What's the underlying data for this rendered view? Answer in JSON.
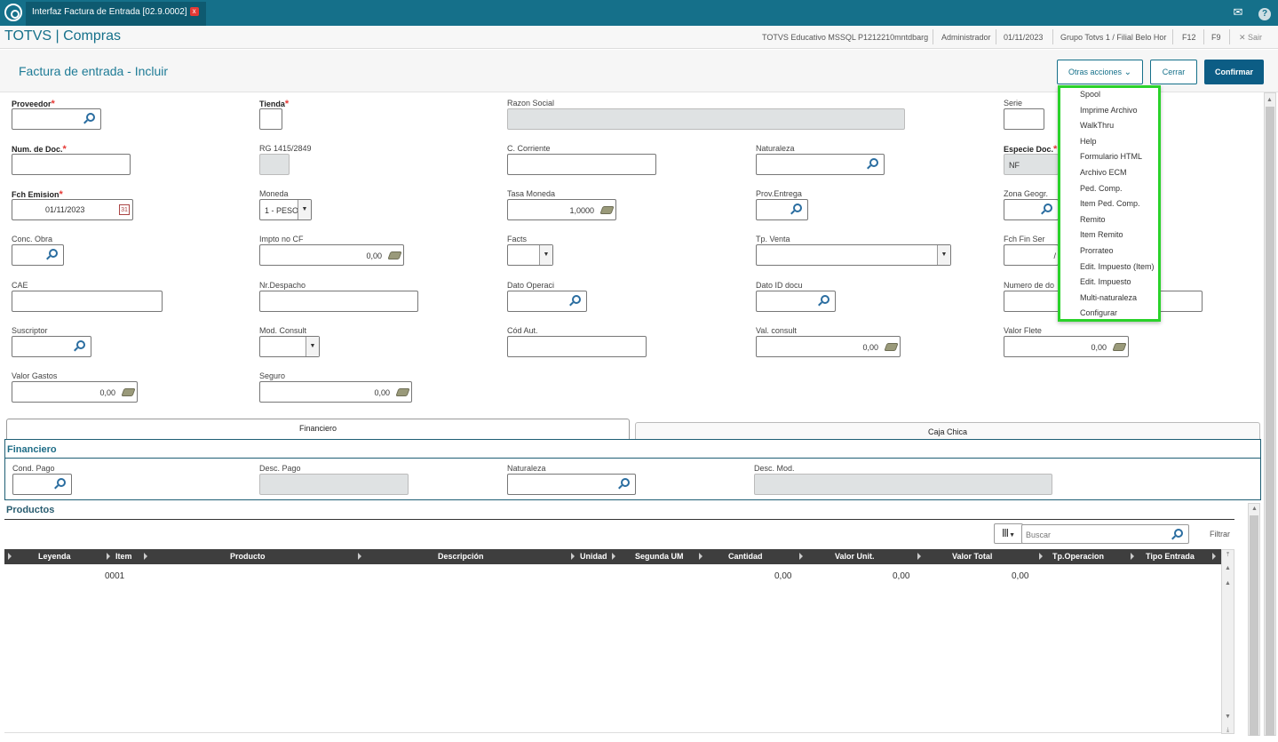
{
  "window": {
    "tab_title": "Interfaz Factura de Entrada [02.9.0002]",
    "close_glyph": "x",
    "mail_icon": "mail-icon",
    "help_glyph": "?"
  },
  "app": {
    "title": "TOTVS | Compras"
  },
  "status": {
    "env": "TOTVS Educativo MSSQL P1212210mntdbarg",
    "user": "Administrador",
    "date": "01/11/2023",
    "branch": "Grupo Totvs 1 / Filial Belo Hor",
    "f12": "F12",
    "f9": "F9",
    "exit": "✕ Sair"
  },
  "page": {
    "title": "Factura de entrada - Incluir"
  },
  "actions": {
    "otras": "Otras acciones",
    "cerrar": "Cerrar",
    "confirmar": "Confirmar"
  },
  "menu": {
    "items": [
      "Spool",
      "Imprime Archivo",
      "WalkThru",
      "Help",
      "Formulario HTML",
      "Archivo ECM",
      "Ped. Comp.",
      "Item Ped. Comp.",
      "Remito",
      "Item Remito",
      "Prorrateo",
      "Edit. Impuesto (Item)",
      "Edit. Impuesto",
      "Multi-naturaleza",
      "Configurar"
    ]
  },
  "form": {
    "proveedor": "Proveedor",
    "tienda": "Tienda",
    "razon_social": "Razon Social",
    "serie": "Serie",
    "num_doc": "Num. de Doc.",
    "rg": "RG 1415/2849",
    "c_corriente": "C. Corriente",
    "naturaleza": "Naturaleza",
    "especie": "Especie Doc.",
    "especie_val": "NF",
    "fch_emision": "Fch Emision",
    "fch_emision_val": "01/11/2023",
    "moneda": "Moneda",
    "moneda_val": "1 - PESO",
    "tasa": "Tasa Moneda",
    "tasa_val": "1,0000",
    "prov_entrega": "Prov.Entrega",
    "zona": "Zona Geogr.",
    "conc_obra": "Conc. Obra",
    "impto": "Impto no CF",
    "impto_val": "0,00",
    "facts": "Facts",
    "tp_venta": "Tp. Venta",
    "fch_fin": "Fch Fin Ser",
    "fch_fin_val": "/",
    "cae": "CAE",
    "nr_despacho": "Nr.Despacho",
    "dato_operaci": "Dato Operaci",
    "dato_id": "Dato ID docu",
    "numero_de_do": "Numero de do",
    "suscriptor": "Suscriptor",
    "mod_consult": "Mod. Consult",
    "cod_aut": "Cód Aut.",
    "val_consult": "Val. consult",
    "val_consult_val": "0,00",
    "valor_flete": "Valor Flete",
    "valor_flete_val": "0,00",
    "valor_gastos": "Valor Gastos",
    "valor_gastos_val": "0,00",
    "seguro": "Seguro",
    "seguro_val": "0,00"
  },
  "tabs": {
    "financiero": "Financiero",
    "caja_chica": "Caja Chica"
  },
  "financiero": {
    "title": "Financiero",
    "cond_pago": "Cond. Pago",
    "desc_pago": "Desc. Pago",
    "naturaleza": "Naturaleza",
    "desc_mod": "Desc. Mod."
  },
  "productos": {
    "title": "Productos",
    "search_placeholder": "Buscar",
    "filtrar": "Filtrar",
    "columns": [
      "Leyenda",
      "Item",
      "Producto",
      "Descripción",
      "Unidad",
      "Segunda UM",
      "Cantidad",
      "Valor Unit.",
      "Valor Total",
      "Tp.Operacion",
      "Tipo Entrada"
    ],
    "rows": [
      {
        "item": "0001",
        "cantidad": "0,00",
        "valor_unit": "0,00",
        "valor_total": "0,00"
      }
    ]
  }
}
